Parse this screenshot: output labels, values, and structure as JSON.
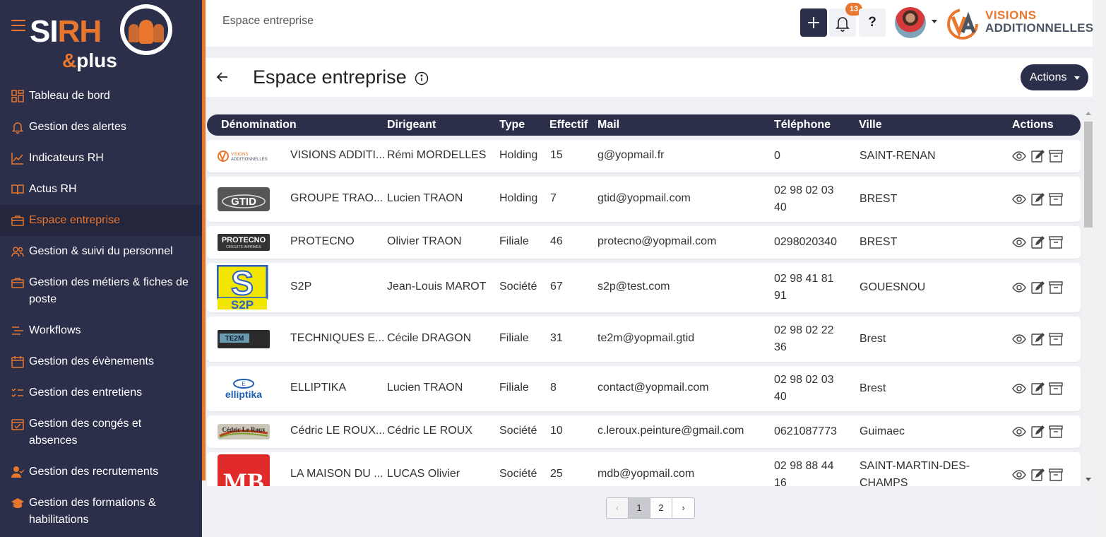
{
  "app": {
    "logo_text": "SIRH",
    "logo_sub": "&plus"
  },
  "sidebar": {
    "items": [
      {
        "label": "Tableau de bord",
        "icon": "dashboard-icon"
      },
      {
        "label": "Gestion des alertes",
        "icon": "bell-icon"
      },
      {
        "label": "Indicateurs RH",
        "icon": "chart-line-icon"
      },
      {
        "label": "Actus RH",
        "icon": "book-icon"
      },
      {
        "label": "Espace entreprise",
        "icon": "briefcase-icon",
        "active": true
      },
      {
        "label": "Gestion & suivi du personnel",
        "icon": "users-icon"
      },
      {
        "label": "Gestion des métiers & fiches de poste",
        "icon": "briefcase-icon"
      },
      {
        "label": "Workflows",
        "icon": "workflow-icon"
      },
      {
        "label": "Gestion des évènements",
        "icon": "calendar-icon"
      },
      {
        "label": "Gestion des entretiens",
        "icon": "checklist-icon"
      },
      {
        "label": "Gestion des congés et absences",
        "icon": "calendar-check-icon"
      },
      {
        "label": "Gestion des recrutements",
        "icon": "user-check-icon"
      },
      {
        "label": "Gestion des formations & habilitations",
        "icon": "graduation-icon"
      }
    ]
  },
  "topbar": {
    "breadcrumb": "Espace entreprise",
    "notifications_count": "13",
    "help_label": "?",
    "brand_line1": "VISIONS",
    "brand_line2": "ADDITIONNELLES"
  },
  "page": {
    "title": "Espace entreprise",
    "actions_label": "Actions"
  },
  "table": {
    "headers": [
      "Dénomination",
      "Dirigeant",
      "Type",
      "Effectif",
      "Mail",
      "Téléphone",
      "Ville",
      "Actions"
    ],
    "rows": [
      {
        "logo": "visions",
        "name": "VISIONS ADDITI...",
        "dirigeant": "Rémi MORDELLES",
        "type": "Holding",
        "effectif": "15",
        "mail": "g@yopmail.fr",
        "tel": "0",
        "ville": "SAINT-RENAN"
      },
      {
        "logo": "gtid",
        "name": "GROUPE TRAO...",
        "dirigeant": "Lucien TRAON",
        "type": "Holding",
        "effectif": "7",
        "mail": "gtid@yopmail.com",
        "tel": "02 98 02 03 40",
        "ville": "BREST"
      },
      {
        "logo": "protecno",
        "name": "PROTECNO",
        "dirigeant": "Olivier TRAON",
        "type": "Filiale",
        "effectif": "46",
        "mail": "protecno@yopmail.com",
        "tel": "0298020340",
        "ville": "BREST"
      },
      {
        "logo": "s2p",
        "name": "S2P",
        "dirigeant": "Jean-Louis MAROT",
        "type": "Société",
        "effectif": "67",
        "mail": "s2p@test.com",
        "tel": "02 98 41 81 91",
        "ville": "GOUESNOU"
      },
      {
        "logo": "te2m",
        "name": "TECHNIQUES E...",
        "dirigeant": "Cécile DRAGON",
        "type": "Filiale",
        "effectif": "31",
        "mail": "te2m@yopmail.gtid",
        "tel": "02 98 02 22 36",
        "ville": "Brest"
      },
      {
        "logo": "elliptika",
        "name": "ELLIPTIKA",
        "dirigeant": "Lucien TRAON",
        "type": "Filiale",
        "effectif": "8",
        "mail": "contact@yopmail.com",
        "tel": "02 98 02 03 40",
        "ville": "Brest"
      },
      {
        "logo": "cedric",
        "name": "Cédric LE ROUX...",
        "dirigeant": "Cédric LE ROUX",
        "type": "Société",
        "effectif": "10",
        "mail": "c.leroux.peinture@gmail.com",
        "tel": "0621087773",
        "ville": "Guimaec"
      },
      {
        "logo": "mdb",
        "name": "LA MAISON DU ...",
        "dirigeant": "LUCAS Olivier",
        "type": "Société",
        "effectif": "25",
        "mail": "mdb@yopmail.com",
        "tel": "02 98 88 44 16",
        "ville": "SAINT-MARTIN-DES-CHAMPS"
      }
    ],
    "logo_texts": {
      "visions": "VISIONS ADDITIONNELLES",
      "gtid": "GTID",
      "protecno": "PROTECNO",
      "protecno_sub": "CIRCUITS IMPRIMES",
      "s2p": "S2P",
      "te2m": "TE2M",
      "elliptika": "elliptika",
      "cedric": "Cédric Le Roux",
      "mdb": "MB"
    }
  },
  "pagination": {
    "prev": "‹",
    "pages": [
      "1",
      "2"
    ],
    "current": "1",
    "next": "›"
  },
  "colors": {
    "navy": "#2b2f4a",
    "accent": "#e8762d",
    "background": "#eef0f5"
  }
}
